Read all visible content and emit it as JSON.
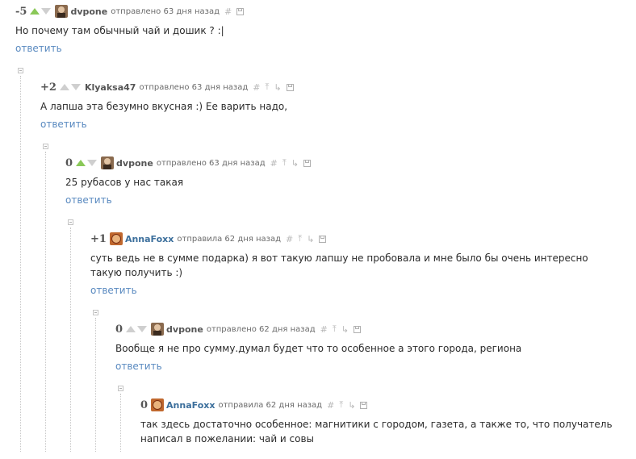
{
  "comments": [
    {
      "rating": "-5",
      "up_active": true,
      "author": "dvpone",
      "avatar": "dvpone",
      "meta": "отправлено 63 дня назад",
      "text": "Но почему там обычный чай и дошик ? :|",
      "reply": "ответить"
    },
    {
      "rating": "+2",
      "up_active": false,
      "author": "Klyaksa47",
      "avatar": "none",
      "meta": "отправлено 63 дня назад",
      "text": "А лапша эта безумно вкусная :) Ее варить надо,",
      "reply": "ответить"
    },
    {
      "rating": "0",
      "up_active": true,
      "author": "dvpone",
      "avatar": "dvpone",
      "meta": "отправлено 63 дня назад",
      "text": "25 рубасов у нас такая",
      "reply": "ответить"
    },
    {
      "rating": "+1",
      "up_active": false,
      "author": "AnnaFoxx",
      "avatar": "anna",
      "meta": "отправила 62 дня назад",
      "text": "суть ведь не в сумме подарка) я вот такую лапшу не пробовала и мне было бы очень интересно такую получить :)",
      "reply": "ответить"
    },
    {
      "rating": "0",
      "up_active": false,
      "author": "dvpone",
      "avatar": "dvpone",
      "meta": "отправлено 62 дня назад",
      "text": "Вообще я не про сумму.думал будет что то особенное а этого города, региона",
      "reply": "ответить"
    },
    {
      "rating": "0",
      "up_active": false,
      "author": "AnnaFoxx",
      "avatar": "anna",
      "meta": "отправила 62 дня назад",
      "text": "так здесь достаточно особенное: магнитики с городом, газета, а также то, что получатель написал в пожелании: чай и совы",
      "reply": ""
    }
  ],
  "icons": {
    "hash": "#",
    "parent": "⤒",
    "branch": "↳",
    "save": "floppy-icon"
  },
  "colors": {
    "upvote": "#8ac858",
    "link": "#5a8ac0",
    "female_author": "#3c6f9c"
  }
}
